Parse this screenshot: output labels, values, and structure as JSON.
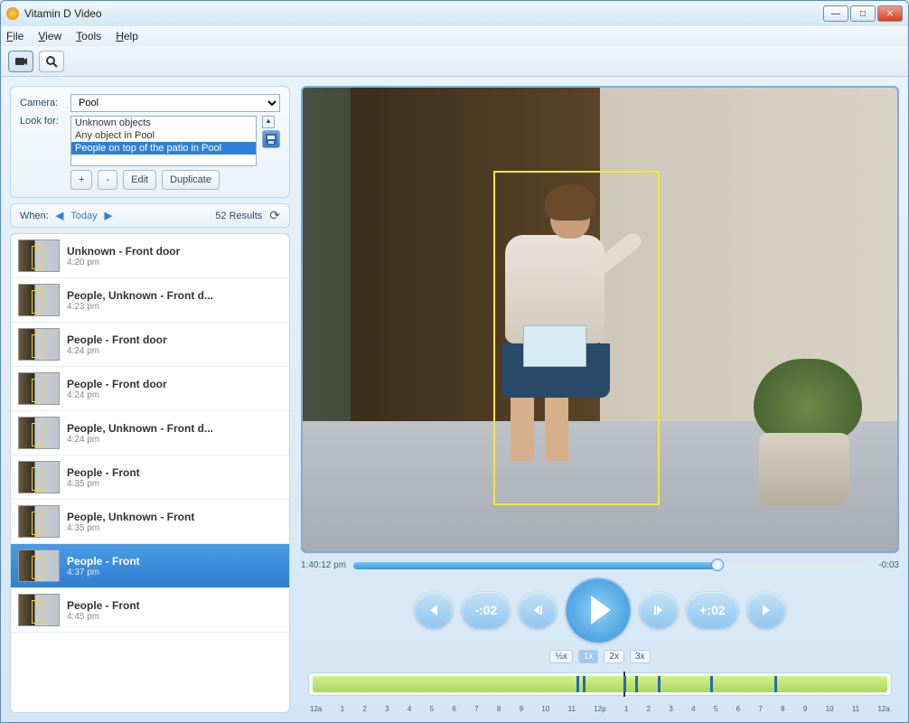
{
  "window": {
    "title": "Vitamin D Video"
  },
  "menu": {
    "file": "File",
    "view": "View",
    "tools": "Tools",
    "help": "Help"
  },
  "sidebar": {
    "camera_label": "Camera:",
    "camera_value": "Pool",
    "lookfor_label": "Look for:",
    "lookfor_options": [
      "Unknown objects",
      "Any object in Pool",
      "People on top of the patio in Pool"
    ],
    "lookfor_selected_index": 2,
    "add_label": "+",
    "remove_label": "-",
    "edit_label": "Edit",
    "duplicate_label": "Duplicate",
    "when_label": "When:",
    "today_label": "Today",
    "results_label": "52 Results"
  },
  "results": [
    {
      "title": "Unknown - Front door",
      "time": "4:20 pm"
    },
    {
      "title": "People, Unknown - Front d...",
      "time": "4:23 pm"
    },
    {
      "title": "People - Front door",
      "time": "4:24 pm"
    },
    {
      "title": "People - Front door",
      "time": "4:24 pm"
    },
    {
      "title": "People, Unknown - Front d...",
      "time": "4:24 pm"
    },
    {
      "title": "People - Front",
      "time": "4:35 pm"
    },
    {
      "title": "People, Unknown - Front",
      "time": "4:35 pm"
    },
    {
      "title": "People - Front",
      "time": "4:37 pm"
    },
    {
      "title": "People - Front",
      "time": "4:45 pm"
    }
  ],
  "selected_result_index": 7,
  "player": {
    "time_elapsed": "1:40:12 pm",
    "time_remaining": "-0:03",
    "skip_back": "-:02",
    "skip_fwd": "+:02",
    "speeds": [
      "½x",
      "1x",
      "2x",
      "3x"
    ],
    "speed_selected": 1,
    "ticks": [
      "12a",
      "1",
      "2",
      "3",
      "4",
      "5",
      "6",
      "7",
      "8",
      "9",
      "10",
      "11",
      "12p",
      "1",
      "2",
      "3",
      "4",
      "5",
      "6",
      "7",
      "8",
      "9",
      "10",
      "11",
      "12a"
    ],
    "marks_pct": [
      46,
      47,
      54,
      56,
      60,
      69,
      80
    ]
  }
}
